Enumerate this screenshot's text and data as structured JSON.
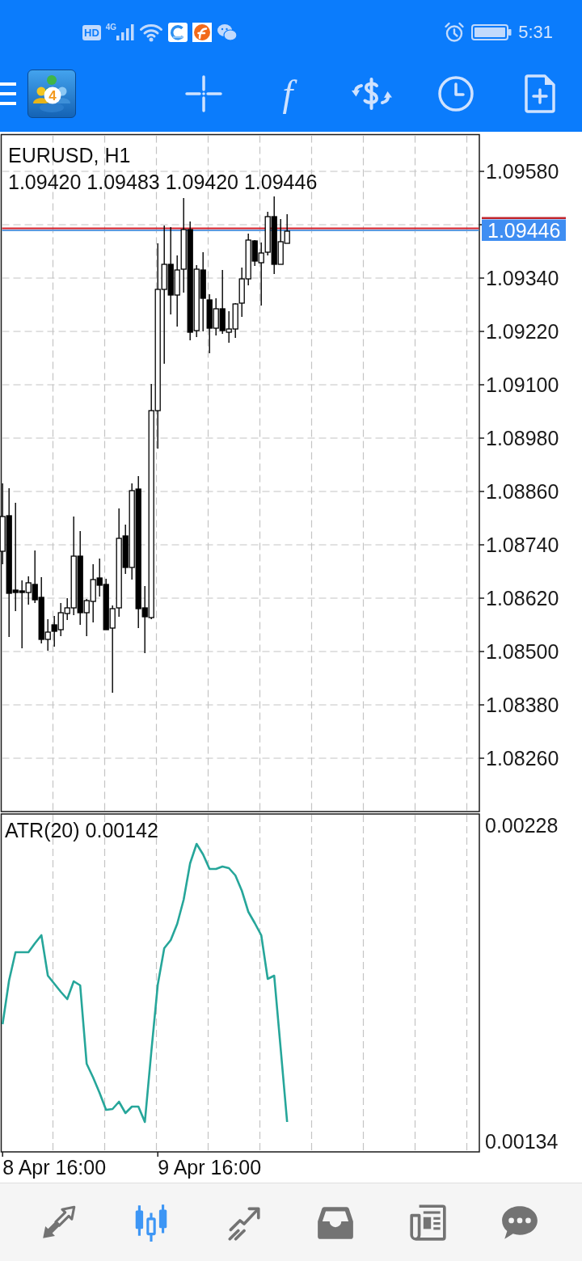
{
  "status_bar": {
    "hd_badge": "HD",
    "network_type": "4G",
    "time": "5:31"
  },
  "toolbar": {
    "logo_badge": "4",
    "function_button": "f"
  },
  "price_chart": {
    "symbol": "EURUSD, H1",
    "ohlc": "1.09420 1.09483 1.09420 1.09446",
    "price_labels": [
      "1.09580",
      "1.09340",
      "1.09220",
      "1.09100",
      "1.08980",
      "1.08860",
      "1.08740",
      "1.08620",
      "1.08500",
      "1.08380",
      "1.08260"
    ],
    "current_price": "1.09446"
  },
  "indicator_panel": {
    "title": "ATR(20) 0.00142",
    "scale_labels": [
      "0.00228",
      "0.00134"
    ]
  },
  "time_axis": {
    "labels": [
      "8 Apr 16:00",
      "9 Apr 16:00"
    ]
  },
  "bottom_nav": [
    {
      "kind": "quotes",
      "selected": false
    },
    {
      "kind": "chart",
      "selected": true
    },
    {
      "kind": "trade",
      "selected": false
    },
    {
      "kind": "history",
      "selected": false
    },
    {
      "kind": "news",
      "selected": false
    },
    {
      "kind": "chat",
      "selected": false
    }
  ]
}
